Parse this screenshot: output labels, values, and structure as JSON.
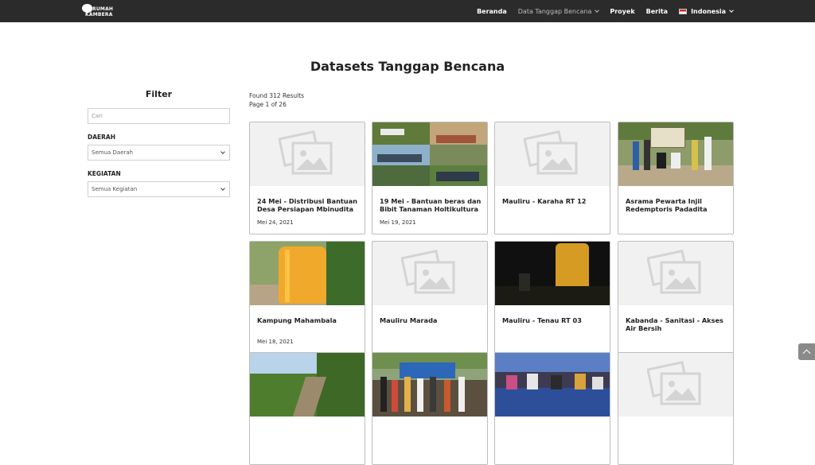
{
  "header": {
    "logo_line1": "RUMAH",
    "logo_line2": "KAMBERA",
    "nav": [
      {
        "label": "Beranda"
      },
      {
        "label": "Data Tanggap Bencana"
      },
      {
        "label": "Proyek"
      },
      {
        "label": "Berita"
      },
      {
        "label": "Indonesia"
      }
    ]
  },
  "page": {
    "title": "Datasets Tanggap Bencana"
  },
  "filter": {
    "title": "Filter",
    "search_placeholder": "Cari",
    "daerah_label": "DAERAH",
    "daerah_value": "Semua Daerah",
    "kegiatan_label": "KEGIATAN",
    "kegiatan_value": "Semua Kegiatan"
  },
  "results": {
    "found": "Found 312 Results",
    "page": "Page 1 of 26"
  },
  "cards": [
    {
      "title": "24 Mei - Distribusi Bantuan Desa Persiapan Mbinudita",
      "date": "Mei 24, 2021",
      "image": "placeholder"
    },
    {
      "title": "19 Mei - Bantuan beras dan Bibit Tanaman Holtikultura",
      "date": "Mei 19, 2021",
      "image": "photo-collage-people"
    },
    {
      "title": "Mauliru - Karaha RT 12",
      "date": "",
      "image": "placeholder"
    },
    {
      "title": "Asrama Pewarta Injil Redemptoris Padadita",
      "date": "",
      "image": "photo-group-sign"
    },
    {
      "title": "Kampung Mahambala",
      "date": "Mei 18, 2021",
      "image": "photo-water-tank"
    },
    {
      "title": "Mauliru Marada",
      "date": "",
      "image": "placeholder"
    },
    {
      "title": "Mauliru - Tenau RT 03",
      "date": "",
      "image": "photo-tank-night"
    },
    {
      "title": "Kabanda - Sanitasi - Akses Air Bersih",
      "date": "",
      "image": "placeholder"
    },
    {
      "title": "",
      "date": "",
      "image": "photo-hillside"
    },
    {
      "title": "",
      "date": "",
      "image": "photo-tent-crowd"
    },
    {
      "title": "",
      "date": "",
      "image": "photo-indoor-meeting"
    },
    {
      "title": "",
      "date": "",
      "image": "placeholder"
    }
  ]
}
